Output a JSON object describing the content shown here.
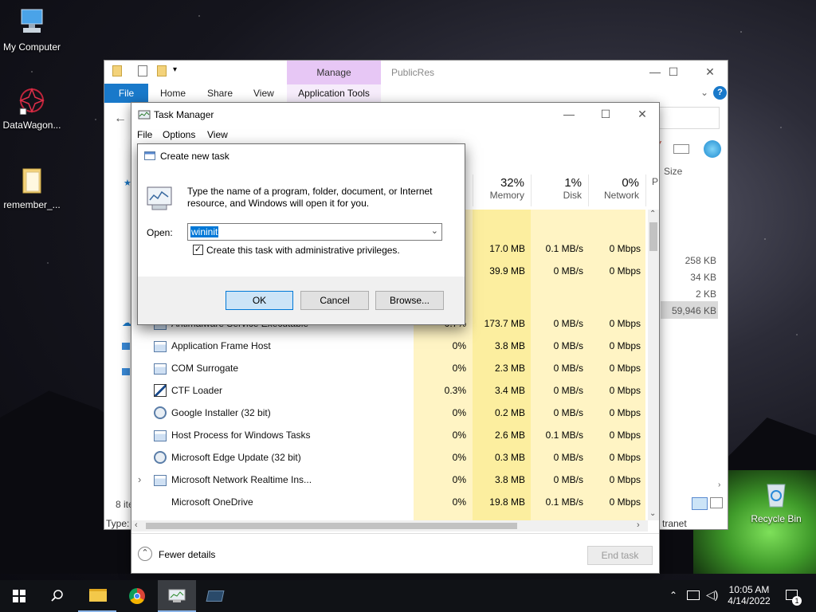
{
  "desktop": {
    "icons": [
      {
        "label": "My Computer"
      },
      {
        "label": "DataWagon..."
      },
      {
        "label": "remember_..."
      },
      {
        "label": "Recycle Bin"
      }
    ]
  },
  "explorer": {
    "title": "PublicRes",
    "tabs": {
      "file": "File",
      "home": "Home",
      "share": "Share",
      "view": "View"
    },
    "manage": {
      "label": "Manage",
      "subtab": "Application Tools"
    },
    "size_header": "Size",
    "sizes": [
      "258 KB",
      "34 KB",
      "2 KB",
      "59,946 KB"
    ],
    "status_left": "8 ite",
    "type_label": "Type:",
    "intranet": "tranet"
  },
  "taskmgr": {
    "title": "Task Manager",
    "menu": {
      "file": "File",
      "options": "Options",
      "view": "View"
    },
    "columns": [
      {
        "pct": "32%",
        "label": "Memory"
      },
      {
        "pct": "1%",
        "label": "Disk"
      },
      {
        "pct": "0%",
        "label": "Network"
      },
      {
        "pct": "",
        "label": "P"
      }
    ],
    "rows": [
      {
        "name": "",
        "cpu": "",
        "mem": "17.0 MB",
        "disk": "0.1 MB/s",
        "net": "0 Mbps"
      },
      {
        "name": "",
        "cpu": "",
        "mem": "39.9 MB",
        "disk": "0 MB/s",
        "net": "0 Mbps"
      },
      {
        "name": "Antimalware Service Executable",
        "cpu": "0.7%",
        "mem": "173.7 MB",
        "disk": "0 MB/s",
        "net": "0 Mbps"
      },
      {
        "name": "Application Frame Host",
        "cpu": "0%",
        "mem": "3.8 MB",
        "disk": "0 MB/s",
        "net": "0 Mbps"
      },
      {
        "name": "COM Surrogate",
        "cpu": "0%",
        "mem": "2.3 MB",
        "disk": "0 MB/s",
        "net": "0 Mbps"
      },
      {
        "name": "CTF Loader",
        "cpu": "0.3%",
        "mem": "3.4 MB",
        "disk": "0 MB/s",
        "net": "0 Mbps"
      },
      {
        "name": "Google Installer (32 bit)",
        "cpu": "0%",
        "mem": "0.2 MB",
        "disk": "0 MB/s",
        "net": "0 Mbps"
      },
      {
        "name": "Host Process for Windows Tasks",
        "cpu": "0%",
        "mem": "2.6 MB",
        "disk": "0.1 MB/s",
        "net": "0 Mbps"
      },
      {
        "name": "Microsoft Edge Update (32 bit)",
        "cpu": "0%",
        "mem": "0.3 MB",
        "disk": "0 MB/s",
        "net": "0 Mbps"
      },
      {
        "name": "Microsoft Network Realtime Ins...",
        "cpu": "0%",
        "mem": "3.8 MB",
        "disk": "0 MB/s",
        "net": "0 Mbps"
      },
      {
        "name": "Microsoft OneDrive",
        "cpu": "0%",
        "mem": "19.8 MB",
        "disk": "0.1 MB/s",
        "net": "0 Mbps"
      }
    ],
    "fewer_details": "Fewer details",
    "end_task": "End task"
  },
  "dialog": {
    "title": "Create new task",
    "description": "Type the name of a program, folder, document, or Internet resource, and Windows will open it for you.",
    "open_label": "Open:",
    "open_value": "wininit",
    "admin_checkbox": "Create this task with administrative privileges.",
    "admin_checked": true,
    "ok": "OK",
    "cancel": "Cancel",
    "browse": "Browse..."
  },
  "taskbar": {
    "time": "10:05 AM",
    "date": "4/14/2022",
    "notification_count": "1"
  }
}
